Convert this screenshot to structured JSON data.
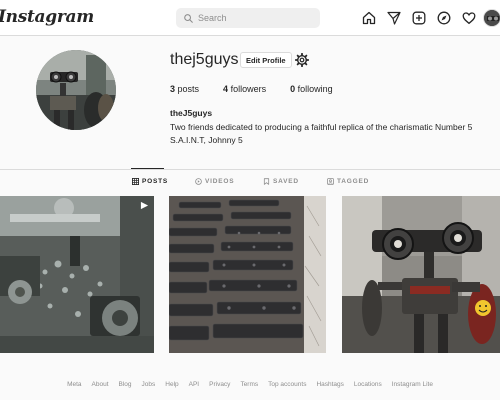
{
  "nav": {
    "logo": "Instagram",
    "search_placeholder": "Search",
    "icons": [
      "home-icon",
      "direct-message-icon",
      "new-post-icon",
      "explore-icon",
      "activity-heart-icon",
      "profile-avatar-icon"
    ]
  },
  "profile": {
    "username": "thej5guys",
    "edit_label": "Edit Profile",
    "stats": {
      "posts_count": "3",
      "posts_label": "posts",
      "followers_count": "4",
      "followers_label": "followers",
      "following_count": "0",
      "following_label": "following"
    },
    "full_name": "theJ5guys",
    "bio": "Two friends dedicated to producing a faithful replica of the charismatic Number 5 S.A.I.N.T, Johnny 5"
  },
  "tabs": [
    {
      "label": "POSTS",
      "icon": "grid-icon",
      "active": true
    },
    {
      "label": "VIDEOS",
      "icon": "video-icon",
      "active": false
    },
    {
      "label": "SAVED",
      "icon": "bookmark-icon",
      "active": false
    },
    {
      "label": "TAGGED",
      "icon": "tagged-icon",
      "active": false
    }
  ],
  "posts": [
    {
      "subject": "lathe-machining-photo",
      "badge": "multi-photo-icon"
    },
    {
      "subject": "machined-parts-photo"
    },
    {
      "subject": "johnny-5-robot-photo"
    }
  ],
  "footer": {
    "links": [
      "Meta",
      "About",
      "Blog",
      "Jobs",
      "Help",
      "API",
      "Privacy",
      "Terms",
      "Top accounts",
      "Hashtags",
      "Locations",
      "Instagram Lite"
    ]
  },
  "colors": {
    "background": "#fafafa",
    "nav_background": "#ffffff",
    "border": "#dbdbdb",
    "text": "#262626",
    "muted": "#8e8e8e"
  }
}
